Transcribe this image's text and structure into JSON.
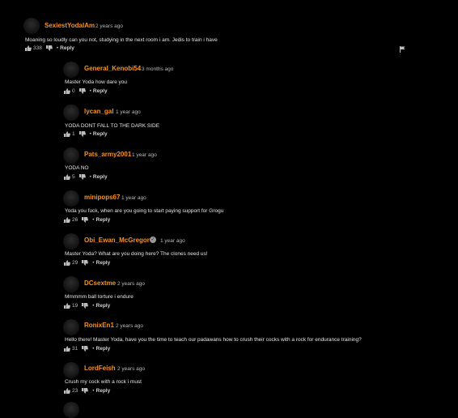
{
  "accent_color": "#f7931e",
  "comments": [
    {
      "username": "SexiestYodaIAm",
      "time": "2 years ago",
      "text": "Moaning so loudly can you not, studying in the next room i am. Jedis to train i have",
      "likes": "338",
      "reply": "Reply"
    },
    {
      "username": "General_Kenobi54",
      "time": "3 months ago",
      "text": "Master Yoda how dare you",
      "likes": "0",
      "reply": "Reply"
    },
    {
      "username": "lycan_gal",
      "time": "1 year ago",
      "text": "YODA DONT FALL TO THE DARK SIDE",
      "likes": "1",
      "reply": "Reply"
    },
    {
      "username": "Pats_army2001",
      "time": "1 year ago",
      "text": "YODA NO",
      "likes": "5",
      "reply": "Reply"
    },
    {
      "username": "minipops67",
      "time": "1 year ago",
      "text": "Yoda you fuck, when are you going to start paying support for Grogu",
      "likes": "26",
      "reply": "Reply"
    },
    {
      "username": "Obi_Ewan_McGregor",
      "time": "1 year ago",
      "text": "Master Yoda? What are you doing here? The clones need us!",
      "likes": "29",
      "reply": "Reply"
    },
    {
      "username": "DCsextme",
      "time": "2 years ago",
      "text": "Mmmmm ball torture i endure",
      "likes": "19",
      "reply": "Reply"
    },
    {
      "username": "RonixEn1",
      "time": "2 years ago",
      "text": "Hello there! Master Yoda, have you the time to teach our padawans how to crush their cocks with a rock for endurance training?",
      "likes": "31",
      "reply": "Reply"
    },
    {
      "username": "LordFeish",
      "time": "2 years ago",
      "text": "Crush my cock with a rock i must",
      "likes": "23",
      "reply": "Reply"
    }
  ]
}
